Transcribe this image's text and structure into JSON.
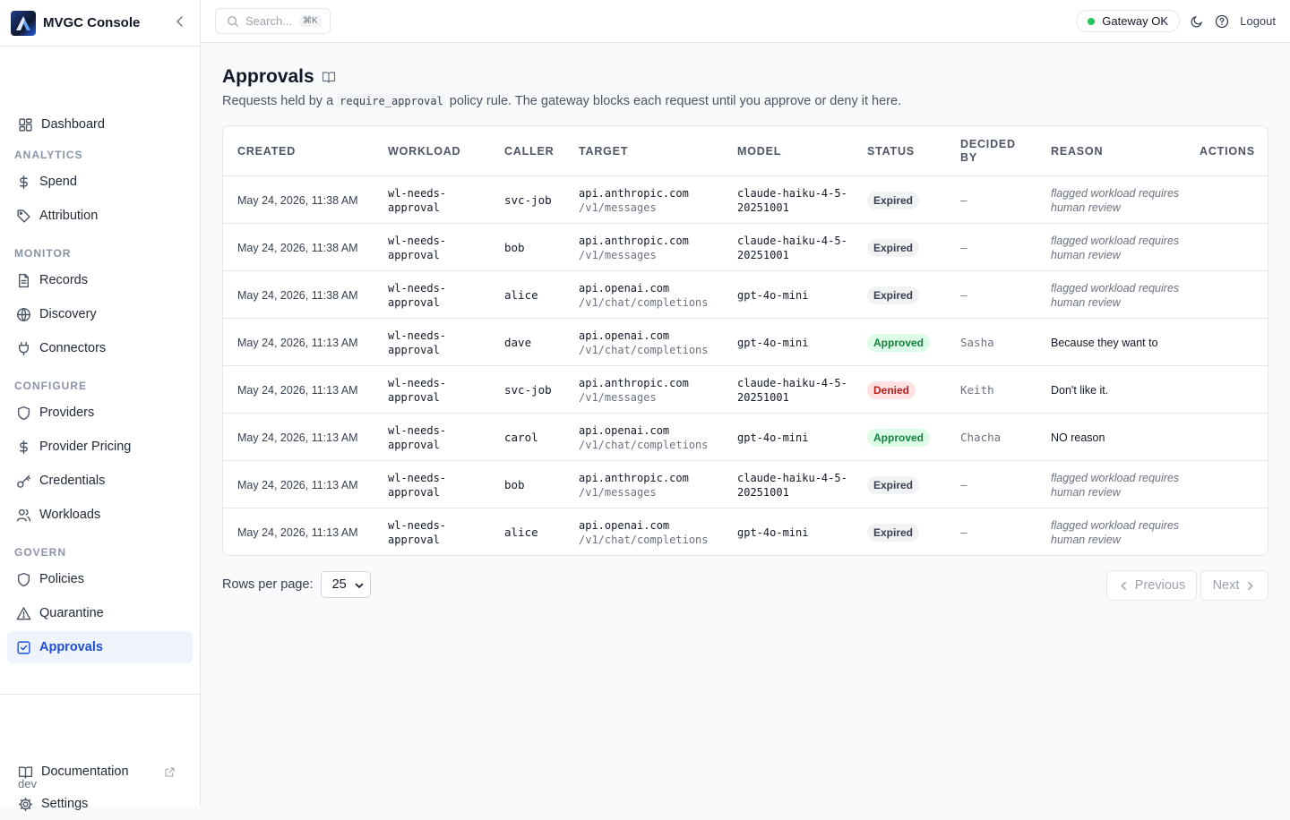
{
  "app": {
    "name": "MVGC Console",
    "env": "dev"
  },
  "sidebar": {
    "top_items": [
      {
        "label": "Dashboard",
        "icon": "grid-icon"
      }
    ],
    "sections": [
      {
        "title": "ANALYTICS",
        "items": [
          {
            "label": "Spend",
            "icon": "dollar-icon"
          },
          {
            "label": "Attribution",
            "icon": "tag-icon"
          }
        ]
      },
      {
        "title": "MONITOR",
        "items": [
          {
            "label": "Records",
            "icon": "file-icon"
          },
          {
            "label": "Discovery",
            "icon": "globe-icon"
          },
          {
            "label": "Connectors",
            "icon": "plug-icon"
          }
        ]
      },
      {
        "title": "CONFIGURE",
        "items": [
          {
            "label": "Providers",
            "icon": "shield-icon"
          },
          {
            "label": "Provider Pricing",
            "icon": "dollar-icon"
          },
          {
            "label": "Credentials",
            "icon": "key-icon"
          },
          {
            "label": "Workloads",
            "icon": "users-icon"
          }
        ]
      },
      {
        "title": "GOVERN",
        "items": [
          {
            "label": "Policies",
            "icon": "shield-icon"
          },
          {
            "label": "Quarantine",
            "icon": "warning-icon"
          },
          {
            "label": "Approvals",
            "icon": "check-square-icon",
            "active": true
          }
        ]
      }
    ],
    "footer": [
      {
        "label": "Documentation",
        "icon": "book-icon"
      },
      {
        "label": "Settings",
        "icon": "gear-icon"
      }
    ]
  },
  "topbar": {
    "search_placeholder": "Search...",
    "search_shortcut": "⌘K",
    "gateway_status": "Gateway OK",
    "gateway_color": "#22c55e",
    "logout": "Logout"
  },
  "page": {
    "title": "Approvals",
    "subtitle_pre": "Requests held by a",
    "subtitle_code": "require_approval",
    "subtitle_post": "policy rule. The gateway blocks each request until you approve or deny it here."
  },
  "table": {
    "columns": {
      "created": "CREATED",
      "workload": "WORKLOAD",
      "caller": "CALLER",
      "target": "TARGET",
      "model": "MODEL",
      "status": "STATUS",
      "decided_by": "DECIDED BY",
      "reason": "REASON",
      "actions": "ACTIONS"
    },
    "rows": [
      {
        "created": "May 24, 2026, 11:38 AM",
        "workload": "wl-needs-approval",
        "caller": "svc-job",
        "host": "api.anthropic.com",
        "path": "/v1/messages",
        "model": "claude-haiku-4-5-20251001",
        "status": "Expired",
        "decided_by": "—",
        "reason": "flagged workload requires human review",
        "reason_muted": true
      },
      {
        "created": "May 24, 2026, 11:38 AM",
        "workload": "wl-needs-approval",
        "caller": "bob",
        "host": "api.anthropic.com",
        "path": "/v1/messages",
        "model": "claude-haiku-4-5-20251001",
        "status": "Expired",
        "decided_by": "—",
        "reason": "flagged workload requires human review",
        "reason_muted": true
      },
      {
        "created": "May 24, 2026, 11:38 AM",
        "workload": "wl-needs-approval",
        "caller": "alice",
        "host": "api.openai.com",
        "path": "/v1/chat/completions",
        "model": "gpt-4o-mini",
        "status": "Expired",
        "decided_by": "—",
        "reason": "flagged workload requires human review",
        "reason_muted": true
      },
      {
        "created": "May 24, 2026, 11:13 AM",
        "workload": "wl-needs-approval",
        "caller": "dave",
        "host": "api.openai.com",
        "path": "/v1/chat/completions",
        "model": "gpt-4o-mini",
        "status": "Approved",
        "decided_by": "Sasha",
        "reason": "Because they want to",
        "reason_muted": false
      },
      {
        "created": "May 24, 2026, 11:13 AM",
        "workload": "wl-needs-approval",
        "caller": "svc-job",
        "host": "api.anthropic.com",
        "path": "/v1/messages",
        "model": "claude-haiku-4-5-20251001",
        "status": "Denied",
        "decided_by": "Keith",
        "reason": "Don't like it.",
        "reason_muted": false
      },
      {
        "created": "May 24, 2026, 11:13 AM",
        "workload": "wl-needs-approval",
        "caller": "carol",
        "host": "api.openai.com",
        "path": "/v1/chat/completions",
        "model": "gpt-4o-mini",
        "status": "Approved",
        "decided_by": "Chacha",
        "reason": "NO reason",
        "reason_muted": false
      },
      {
        "created": "May 24, 2026, 11:13 AM",
        "workload": "wl-needs-approval",
        "caller": "bob",
        "host": "api.anthropic.com",
        "path": "/v1/messages",
        "model": "claude-haiku-4-5-20251001",
        "status": "Expired",
        "decided_by": "—",
        "reason": "flagged workload requires human review",
        "reason_muted": true
      },
      {
        "created": "May 24, 2026, 11:13 AM",
        "workload": "wl-needs-approval",
        "caller": "alice",
        "host": "api.openai.com",
        "path": "/v1/chat/completions",
        "model": "gpt-4o-mini",
        "status": "Expired",
        "decided_by": "—",
        "reason": "flagged workload requires human review",
        "reason_muted": true
      }
    ]
  },
  "pagination": {
    "rows_per_page_label": "Rows per page:",
    "rows_per_page": "25",
    "previous": "Previous",
    "next": "Next"
  }
}
